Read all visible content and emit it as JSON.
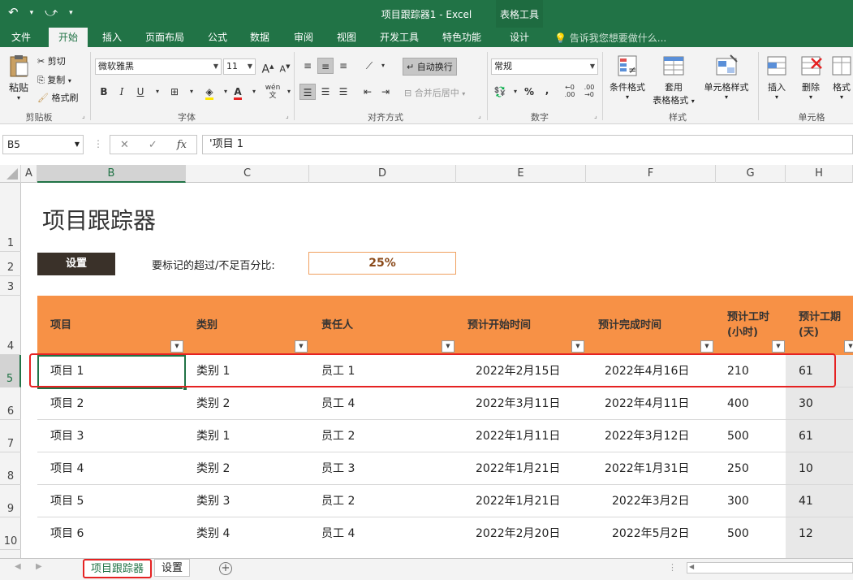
{
  "window": {
    "title": "项目跟踪器1 - Excel",
    "context_group": "表格工具"
  },
  "tabs": [
    "文件",
    "开始",
    "插入",
    "页面布局",
    "公式",
    "数据",
    "审阅",
    "视图",
    "开发工具",
    "特色功能",
    "设计"
  ],
  "tell_me": "告诉我您想要做什么...",
  "ribbon": {
    "clipboard": {
      "paste": "粘贴",
      "cut": "剪切",
      "copy": "复制",
      "format_painter": "格式刷",
      "group": "剪贴板"
    },
    "font": {
      "name": "微软雅黑",
      "size": "11",
      "grow": "A",
      "shrink": "A",
      "bold": "B",
      "italic": "I",
      "underline": "U",
      "wen": "wén",
      "group": "字体"
    },
    "alignment": {
      "wrap": "自动换行",
      "merge": "合并后居中",
      "group": "对齐方式"
    },
    "number": {
      "format": "常规",
      "percent": "%",
      "comma": ",",
      "group": "数字"
    },
    "styles": {
      "conditional": "条件格式",
      "table_format_1": "套用",
      "table_format_2": "表格格式",
      "cell_styles": "单元格样式",
      "group": "样式"
    },
    "cells": {
      "insert": "插入",
      "delete": "删除",
      "format": "格式",
      "group": "单元格"
    }
  },
  "formula_bar": {
    "name_box": "B5",
    "formula": "'项目 1",
    "cancel": "✕",
    "enter": "✓",
    "fx": "fx"
  },
  "columns": [
    "A",
    "B",
    "C",
    "D",
    "E",
    "F",
    "G",
    "H"
  ],
  "rows": [
    "1",
    "2",
    "3",
    "4",
    "5",
    "6",
    "7",
    "8",
    "9",
    "10"
  ],
  "sheet": {
    "title": "项目跟踪器",
    "settings_button": "设置",
    "flag_label": "要标记的超过/不足百分比:",
    "flag_value": "25%",
    "headers": [
      "项目",
      "类别",
      "责任人",
      "预计开始时间",
      "预计完成时间",
      "预计工时",
      "(小时)",
      "预计工期",
      "(天)"
    ],
    "rows": [
      [
        "项目 1",
        "类别 1",
        "员工 1",
        "2022年2月15日",
        "2022年4月16日",
        "210",
        "61"
      ],
      [
        "项目 2",
        "类别 2",
        "员工 4",
        "2022年3月11日",
        "2022年4月11日",
        "400",
        "30"
      ],
      [
        "项目 3",
        "类别 1",
        "员工 2",
        "2022年1月11日",
        "2022年3月12日",
        "500",
        "61"
      ],
      [
        "项目 4",
        "类别 2",
        "员工 3",
        "2022年1月21日",
        "2022年1月31日",
        "250",
        "10"
      ],
      [
        "项目 5",
        "类别 3",
        "员工 2",
        "2022年1月21日",
        "2022年3月2日",
        "300",
        "41"
      ],
      [
        "项目 6",
        "类别 4",
        "员工 4",
        "2022年2月20日",
        "2022年5月2日",
        "500",
        "12"
      ]
    ]
  },
  "sheet_tabs": [
    "项目跟踪器",
    "设置"
  ],
  "colors": {
    "excel_green": "#217346",
    "header_orange": "#f79146",
    "highlight_red": "#e52222"
  }
}
